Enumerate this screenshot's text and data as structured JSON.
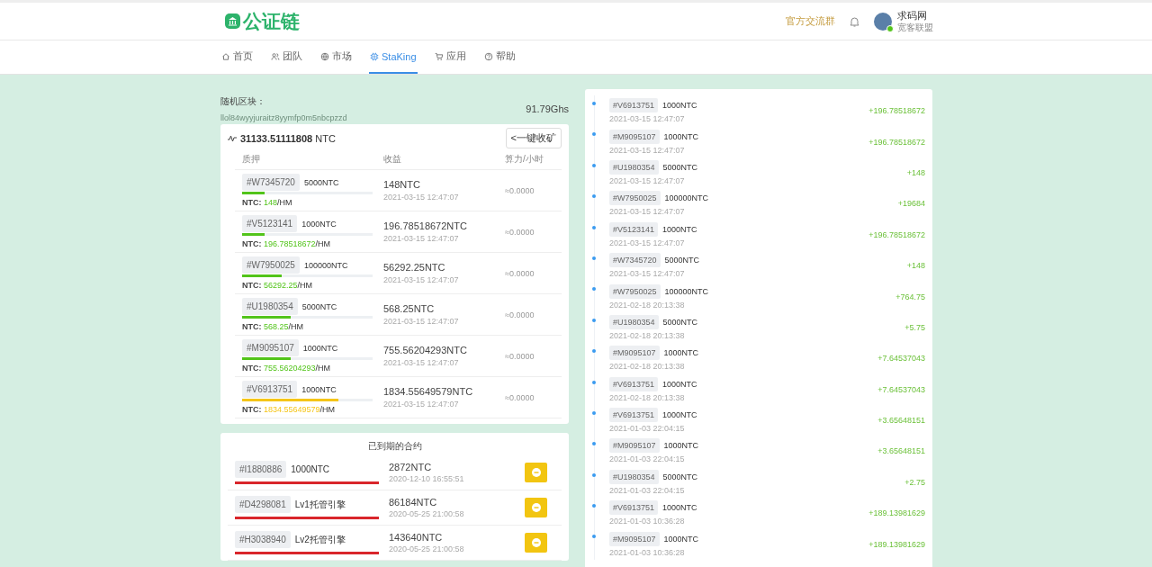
{
  "header": {
    "logo": "公证链",
    "group_link": "官方交流群",
    "user": {
      "name": "求码网",
      "subtitle": "宽客联盟",
      "online": true
    }
  },
  "nav": [
    {
      "label": "首页",
      "kind": "home",
      "selected": false
    },
    {
      "label": "团队",
      "kind": "team",
      "selected": false
    },
    {
      "label": "市场",
      "kind": "globe",
      "selected": false
    },
    {
      "label": "StaKing",
      "kind": "chip",
      "selected": true
    },
    {
      "label": "应用",
      "kind": "cart",
      "selected": false
    },
    {
      "label": "帮助",
      "kind": "help",
      "selected": false
    }
  ],
  "block": {
    "label": "随机区块：",
    "hash": "llol84wyyjuraitz8yymfp0m5nbcpzzd",
    "hashrate": "91.79Ghs"
  },
  "stake": {
    "total": "**31133.51111808** NTC",
    "button": "<一键收矿",
    "columns": [
      "质押",
      "收益",
      "算力/小时"
    ],
    "rows": [
      {
        "id": "#W7345720",
        "amount": "5000NTC",
        "level": 0.17,
        "color": "#52c41a",
        "ntc_label": "NTC:",
        "ntc_value": "148",
        "ntc_unit": "/HM",
        "earning": "148NTC",
        "time": "2021-03-15 12:47:07",
        "rate": "≈0.0000"
      },
      {
        "id": "#V5123141",
        "amount": "1000NTC",
        "level": 0.17,
        "color": "#52c41a",
        "ntc_label": "NTC:",
        "ntc_value": "196.78518672",
        "ntc_unit": "/HM",
        "earning": "196.78518672NTC",
        "time": "2021-03-15 12:47:07",
        "rate": "≈0.0000"
      },
      {
        "id": "#W7950025",
        "amount": "100000NTC",
        "level": 0.3,
        "color": "#52c41a",
        "ntc_label": "NTC:",
        "ntc_value": "56292.25",
        "ntc_unit": "/HM",
        "earning": "56292.25NTC",
        "time": "2021-03-15 12:47:07",
        "rate": "≈0.0000"
      },
      {
        "id": "#U1980354",
        "amount": "5000NTC",
        "level": 0.37,
        "color": "#52c41a",
        "ntc_label": "NTC:",
        "ntc_value": "568.25",
        "ntc_unit": "/HM",
        "earning": "568.25NTC",
        "time": "2021-03-15 12:47:07",
        "rate": "≈0.0000"
      },
      {
        "id": "#M9095107",
        "amount": "1000NTC",
        "level": 0.37,
        "color": "#52c41a",
        "ntc_label": "NTC:",
        "ntc_value": "755.56204293",
        "ntc_unit": "/HM",
        "earning": "755.56204293NTC",
        "time": "2021-03-15 12:47:07",
        "rate": "≈0.0000"
      },
      {
        "id": "#V6913751",
        "amount": "1000NTC",
        "level": 0.74,
        "color": "#f5c518",
        "ntc_label": "NTC:",
        "ntc_value": "1834.55649579",
        "ntc_unit": "/HM",
        "earning": "1834.55649579NTC",
        "time": "2021-03-15 12:47:07",
        "rate": "≈0.0000"
      }
    ]
  },
  "expired": {
    "title": "已到期的合约",
    "rows": [
      {
        "id": "#I1880886",
        "name": "1000NTC",
        "level": 1,
        "earning": "2872NTC",
        "time": "2020-12-10 16:55:51"
      },
      {
        "id": "#D4298081",
        "name": "Lv1托管引擎",
        "level": 1,
        "earning": "86184NTC",
        "time": "2020-05-25 21:00:58"
      },
      {
        "id": "#H3038940",
        "name": "Lv2托管引擎",
        "level": 1,
        "earning": "143640NTC",
        "time": "2020-05-25 21:00:58"
      }
    ]
  },
  "records": [
    {
      "id": "#V6913751",
      "amount": "1000NTC",
      "time": "2021-03-15 12:47:07",
      "gain": "+196.78518672"
    },
    {
      "id": "#M9095107",
      "amount": "1000NTC",
      "time": "2021-03-15 12:47:07",
      "gain": "+196.78518672"
    },
    {
      "id": "#U1980354",
      "amount": "5000NTC",
      "time": "2021-03-15 12:47:07",
      "gain": "+148"
    },
    {
      "id": "#W7950025",
      "amount": "100000NTC",
      "time": "2021-03-15 12:47:07",
      "gain": "+19684"
    },
    {
      "id": "#V5123141",
      "amount": "1000NTC",
      "time": "2021-03-15 12:47:07",
      "gain": "+196.78518672"
    },
    {
      "id": "#W7345720",
      "amount": "5000NTC",
      "time": "2021-03-15 12:47:07",
      "gain": "+148"
    },
    {
      "id": "#W7950025",
      "amount": "100000NTC",
      "time": "2021-02-18 20:13:38",
      "gain": "+764.75"
    },
    {
      "id": "#U1980354",
      "amount": "5000NTC",
      "time": "2021-02-18 20:13:38",
      "gain": "+5.75"
    },
    {
      "id": "#M9095107",
      "amount": "1000NTC",
      "time": "2021-02-18 20:13:38",
      "gain": "+7.64537043"
    },
    {
      "id": "#V6913751",
      "amount": "1000NTC",
      "time": "2021-02-18 20:13:38",
      "gain": "+7.64537043"
    },
    {
      "id": "#V6913751",
      "amount": "1000NTC",
      "time": "2021-01-03 22:04:15",
      "gain": "+3.65648151"
    },
    {
      "id": "#M9095107",
      "amount": "1000NTC",
      "time": "2021-01-03 22:04:15",
      "gain": "+3.65648151"
    },
    {
      "id": "#U1980354",
      "amount": "5000NTC",
      "time": "2021-01-03 22:04:15",
      "gain": "+2.75"
    },
    {
      "id": "#V6913751",
      "amount": "1000NTC",
      "time": "2021-01-03 10:36:28",
      "gain": "+189.13981629"
    },
    {
      "id": "#M9095107",
      "amount": "1000NTC",
      "time": "2021-01-03 10:36:28",
      "gain": "+189.13981629"
    }
  ]
}
